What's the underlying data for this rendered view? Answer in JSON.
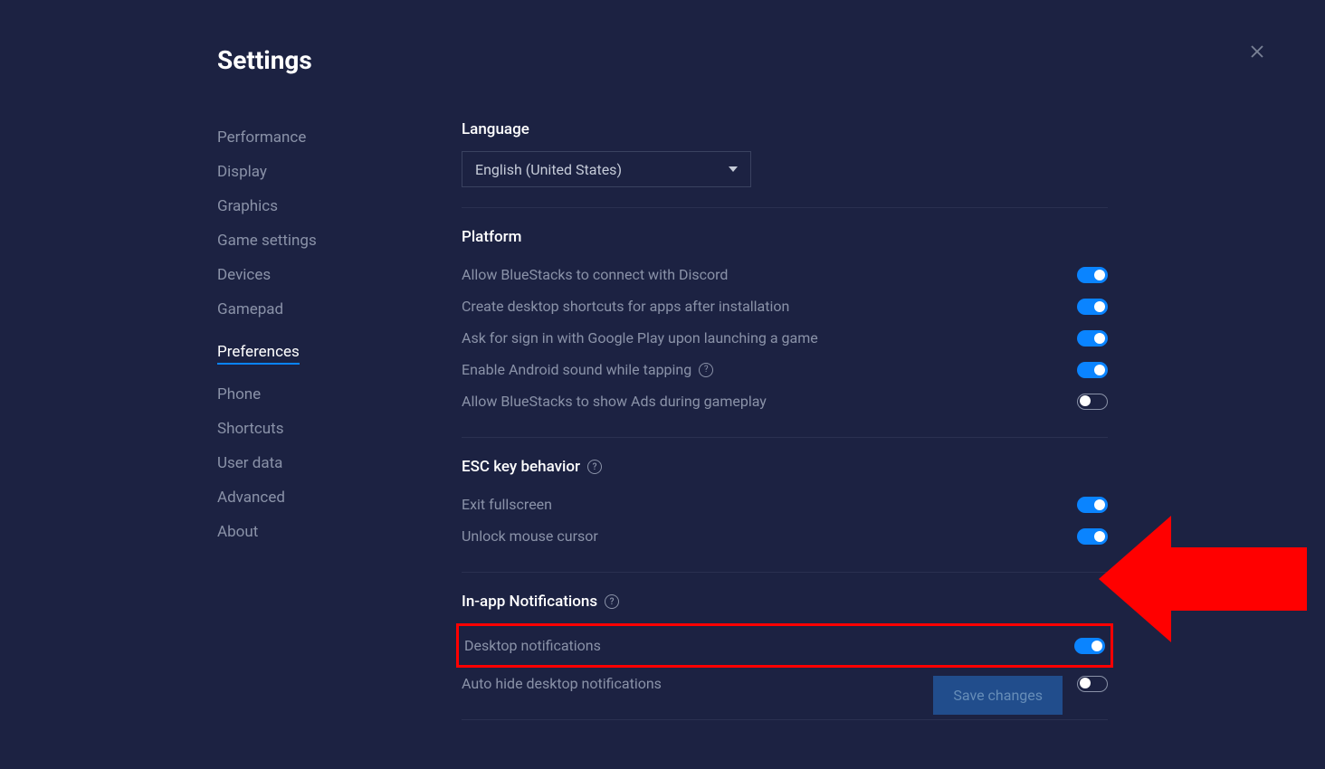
{
  "header": {
    "title": "Settings"
  },
  "sidebar": {
    "items": [
      {
        "label": "Performance",
        "active": false
      },
      {
        "label": "Display",
        "active": false
      },
      {
        "label": "Graphics",
        "active": false
      },
      {
        "label": "Game settings",
        "active": false
      },
      {
        "label": "Devices",
        "active": false
      },
      {
        "label": "Gamepad",
        "active": false
      },
      {
        "label": "Preferences",
        "active": true
      },
      {
        "label": "Phone",
        "active": false
      },
      {
        "label": "Shortcuts",
        "active": false
      },
      {
        "label": "User data",
        "active": false
      },
      {
        "label": "Advanced",
        "active": false
      },
      {
        "label": "About",
        "active": false
      }
    ]
  },
  "sections": {
    "language": {
      "title": "Language",
      "selected": "English (United States)"
    },
    "platform": {
      "title": "Platform",
      "items": [
        {
          "label": "Allow BlueStacks to connect with Discord",
          "on": true,
          "help": false
        },
        {
          "label": "Create desktop shortcuts for apps after installation",
          "on": true,
          "help": false
        },
        {
          "label": "Ask for sign in with Google Play upon launching a game",
          "on": true,
          "help": false
        },
        {
          "label": "Enable Android sound while tapping",
          "on": true,
          "help": true
        },
        {
          "label": "Allow BlueStacks to show Ads during gameplay",
          "on": false,
          "help": false
        }
      ]
    },
    "esc": {
      "title": "ESC key behavior",
      "items": [
        {
          "label": "Exit fullscreen",
          "on": true
        },
        {
          "label": "Unlock mouse cursor",
          "on": true
        }
      ]
    },
    "notifications": {
      "title": "In-app Notifications",
      "items": [
        {
          "label": "Desktop notifications",
          "on": true,
          "highlighted": true
        },
        {
          "label": "Auto hide desktop notifications",
          "on": false,
          "highlighted": false
        }
      ]
    }
  },
  "footer": {
    "save": "Save changes"
  }
}
